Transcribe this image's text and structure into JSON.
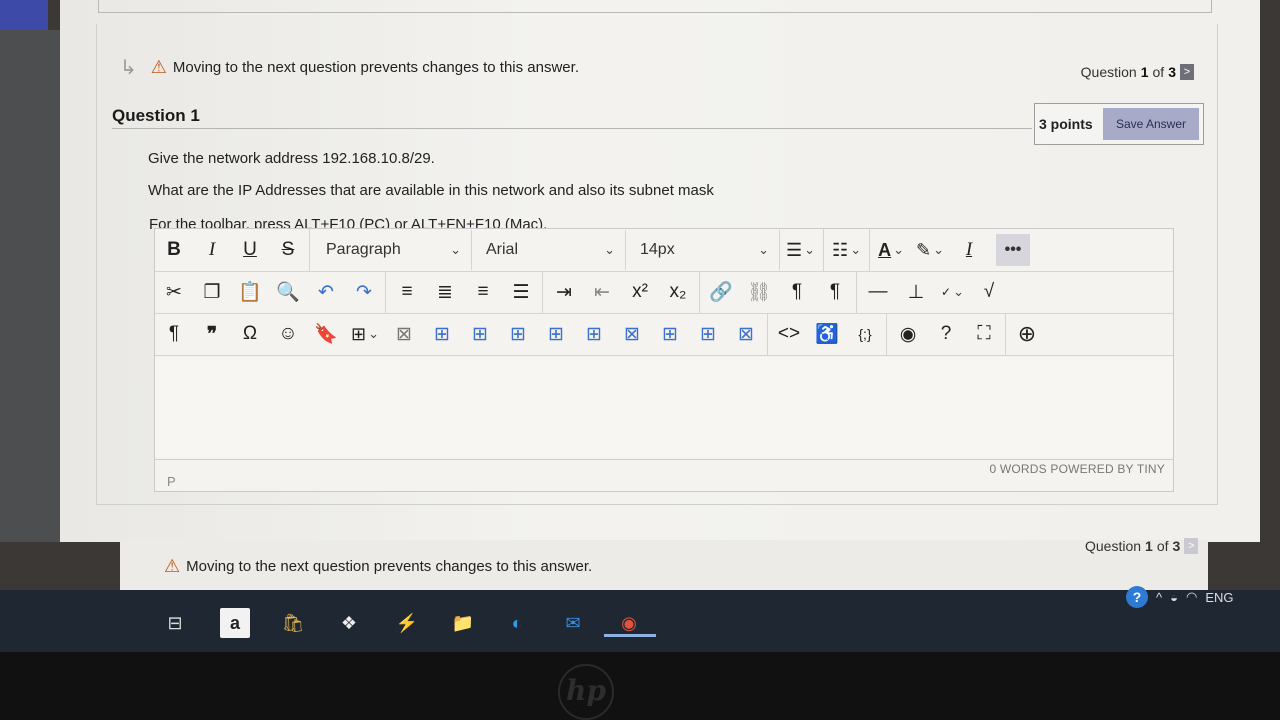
{
  "warning": {
    "text": "Moving to the next question prevents changes to this answer."
  },
  "question_nav": {
    "prefix": "Question",
    "current": "1",
    "of": "of",
    "total": "3",
    "next_icon": ">"
  },
  "question": {
    "title": "Question 1",
    "points": "3 points",
    "save_label": "Save Answer",
    "lines": [
      "Give the network address 192.168.10.8/29.",
      "What are the  IP Addresses that are available in this network and also its subnet mask"
    ]
  },
  "editor": {
    "instructions": "For the toolbar, press ALT+F10 (PC) or ALT+FN+F10 (Mac).",
    "block_format": "Paragraph",
    "font_family": "Arial",
    "font_size": "14px",
    "status_path": "P",
    "status_words": "0 WORDS  POWERED BY TINY",
    "more_label": "•••"
  },
  "taskbar": {
    "tray_lang": "ENG"
  },
  "colors": {
    "accent_button": "#a8abc7",
    "warning": "#c2571a",
    "taskbar": "#1f2733"
  }
}
